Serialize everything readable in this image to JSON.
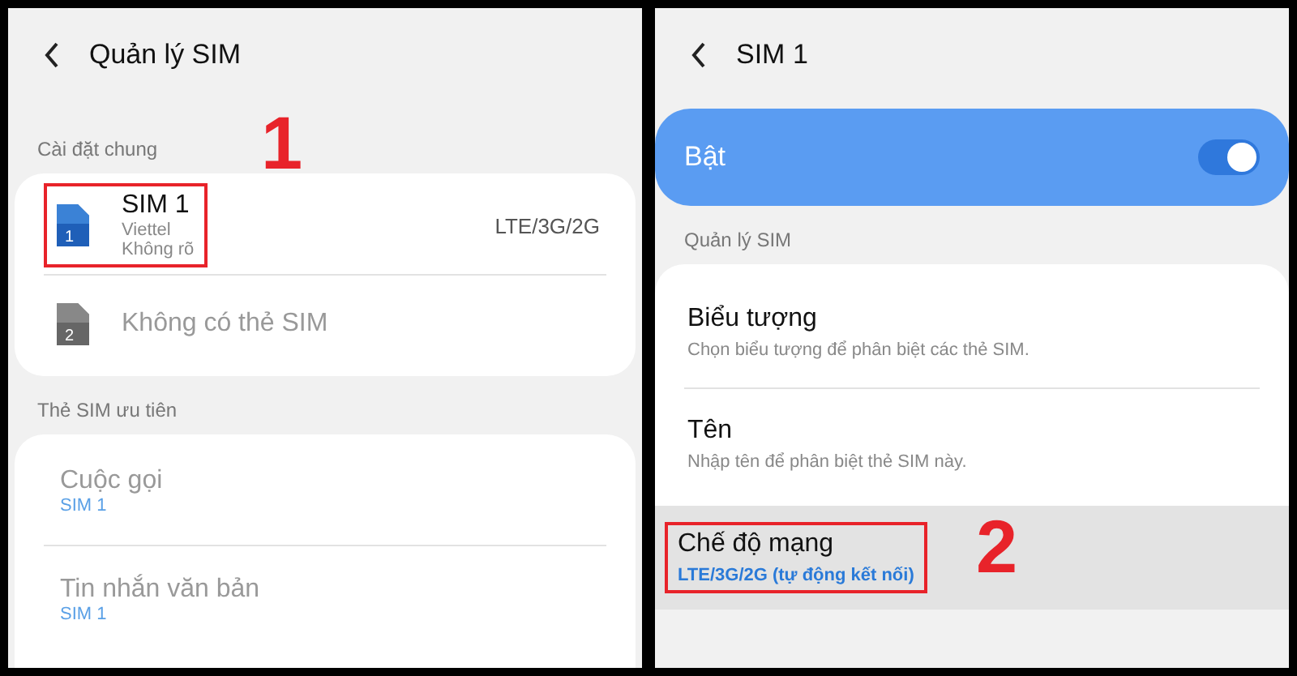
{
  "left_screen": {
    "title": "Quản lý SIM",
    "sections": [
      {
        "header": "Cài đặt chung",
        "items": [
          {
            "kind": "sim",
            "title": "SIM 1",
            "lines": [
              "Viettel",
              "Không rõ"
            ],
            "value": "LTE/3G/2G",
            "sim_number": "1",
            "disabled": false,
            "highlighted": true,
            "callout": "1"
          },
          {
            "kind": "sim",
            "title": "Không có thẻ SIM",
            "sim_number": "2",
            "disabled": true,
            "highlighted": false
          }
        ]
      },
      {
        "header": "Thẻ SIM ưu tiên",
        "items": [
          {
            "kind": "pref",
            "title": "Cuộc gọi",
            "lines": [
              "SIM 1"
            ],
            "disabled": true,
            "highlighted": false
          },
          {
            "kind": "pref",
            "title": "Tin nhắn văn bản",
            "lines": [
              "SIM 1"
            ],
            "disabled": true,
            "highlighted": false
          }
        ]
      }
    ]
  },
  "right_screen": {
    "title": "SIM 1",
    "master_switch": {
      "label": "Bật",
      "on": true
    },
    "section_header": "Quản lý SIM",
    "items": [
      {
        "title": "Biểu tượng",
        "subtitle": "Chọn biểu tượng để phân biệt các thẻ SIM.",
        "selected": false,
        "highlighted": false
      },
      {
        "title": "Tên",
        "subtitle": "Nhập tên để phân biệt thẻ SIM này.",
        "selected": false,
        "highlighted": false
      },
      {
        "title": "Chế độ mạng",
        "subtitle": "LTE/3G/2G (tự động kết nối)",
        "selected": true,
        "highlighted": true,
        "callout": "2"
      }
    ]
  }
}
